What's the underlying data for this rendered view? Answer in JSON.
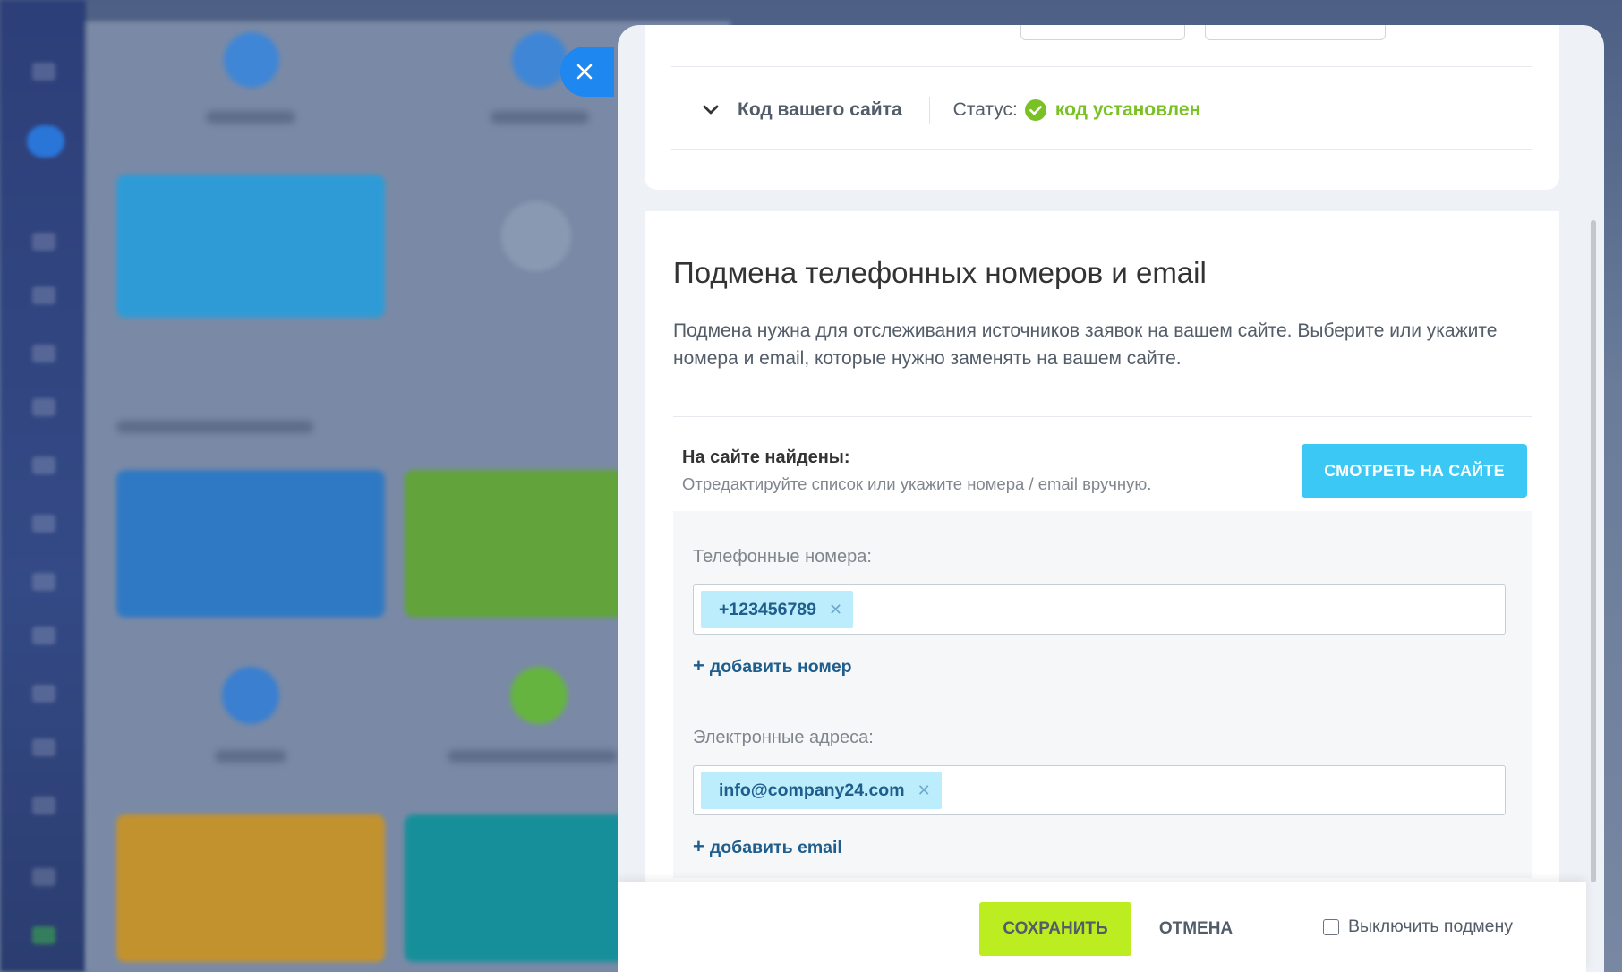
{
  "site_code": {
    "toggle_label": "Код вашего сайта",
    "status_label": "Статус:",
    "status_value": "код установлен"
  },
  "substitution": {
    "title": "Подмена телефонных номеров и email",
    "description": "Подмена нужна для отслеживания источников заявок на вашем сайте. Выберите или укажите номера и email, которые нужно заменять на вашем сайте.",
    "found": {
      "title": "На сайте найдены:",
      "subtitle": "Отредактируйте список или укажите номера / email вручную.",
      "view_button": "СМОТРЕТЬ НА САЙТЕ"
    },
    "phones": {
      "label": "Телефонные номера:",
      "items": [
        "+123456789"
      ],
      "add_link": "добавить номер"
    },
    "emails": {
      "label": "Электронные адреса:",
      "items": [
        "info@company24.com"
      ],
      "add_link": "добавить email"
    }
  },
  "footer": {
    "save": "СОХРАНИТЬ",
    "cancel": "ОТМЕНА",
    "disable_checkbox": "Выключить подмену",
    "disable_checked": false
  },
  "icons": {
    "close": "close-icon",
    "chevron": "chevron-down-icon",
    "status": "check-circle-icon",
    "remove": "remove-tag-icon",
    "add": "plus-icon"
  },
  "colors": {
    "accent_blue": "#1e87f0",
    "status_green": "#7ac125",
    "view_button": "#3bc8f5",
    "save_button": "#bbed21",
    "tag_bg": "#bcedfc",
    "link": "#1f5d8c"
  }
}
